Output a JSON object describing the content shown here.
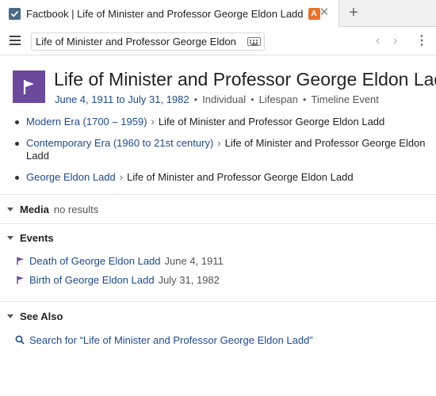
{
  "tab": {
    "title": "Factbook | Life of Minister and Professor George Eldon Ladd",
    "badge": "A",
    "close": "✕",
    "new_tab": "+"
  },
  "toolbar": {
    "search_value": "Life of Minister and Professor George Eldon",
    "back": "‹",
    "forward": "›",
    "more": "⋮"
  },
  "header": {
    "title": "Life of Minister and Professor George Eldon Ladd",
    "date_range": "June 4, 1911 to July 31, 1982",
    "tags": [
      "Individual",
      "Lifespan",
      "Timeline Event"
    ]
  },
  "breadcrumbs": [
    {
      "link": "Modern Era (1700 – 1959)",
      "separator": "›",
      "text": "Life of Minister and Professor George Eldon Ladd"
    },
    {
      "link": "Contemporary Era (1960 to 21st century)",
      "separator": "›",
      "text": "Life of Minister and Professor George Eldon Ladd"
    },
    {
      "link": "George Eldon Ladd",
      "separator": "›",
      "text": "Life of Minister and Professor George Eldon Ladd"
    }
  ],
  "media": {
    "label": "Media",
    "status": "no results"
  },
  "events": {
    "label": "Events",
    "items": [
      {
        "title": "Death of George Eldon Ladd",
        "date": "June 4, 1911"
      },
      {
        "title": "Birth of George Eldon Ladd",
        "date": "July 31, 1982"
      }
    ]
  },
  "see_also": {
    "label": "See Also",
    "search_link": "Search for “Life of Minister and Professor George Eldon Ladd”"
  },
  "colors": {
    "accent": "#6b4a9c",
    "link": "#1e4a8a",
    "badge": "#e8722a"
  },
  "icons": {
    "app": "factbook-check-icon",
    "entry": "flag-icon",
    "search": "search-icon"
  }
}
